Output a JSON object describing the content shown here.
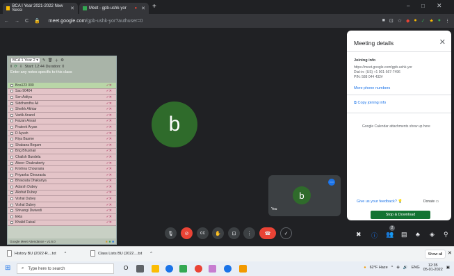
{
  "browser": {
    "tabs": [
      {
        "label": "BCA I Year 2021-2022 New Sessi",
        "active": false,
        "color": "#fbbc04"
      },
      {
        "label": "Meet - gpb-ushk-yor",
        "active": true,
        "color": "#34a853"
      }
    ],
    "url_host": "meet.google.com",
    "url_path": "/gpb-ushk-yor?authuser=0"
  },
  "extension": {
    "class_select": "BCA 1 Year 2 ▾",
    "hint": "Enter any notes specific to this class",
    "stats": "Start: 12:44 Duration: 0",
    "students": [
      "Bca123 000",
      "Sao 90404",
      "Sen Aditya",
      "Siddhandhu Ali",
      "Sheikh Akhtar",
      "Vartik Anand",
      "Faizan Ansari",
      "Prateek Aryan",
      "D Ayush",
      "Riya Basme",
      "Shabana Begam",
      "Brig Bhushan",
      "Chailsh Bundela",
      "Abeer Chakraborty",
      "Krishna Chourasia",
      "Priyanka Chourasia",
      "Bhavyata Dhakariya",
      "Adarsh Dubey",
      "Akshat Dubey",
      "Vishal Dubey",
      "Vishal Dubey",
      "Shivangi Dwivedi",
      "Ekta",
      "Khalid Faisal"
    ],
    "footer": "Google Meet Attendance - v1.6.0"
  },
  "stage": {
    "main_avatar": "b",
    "self_avatar": "b",
    "self_label": "You"
  },
  "details": {
    "title": "Meeting details",
    "joining_info": "Joining info",
    "link": "https://meet.google.com/gpb-ushk-yor",
    "dial_in": "Dial-in: (US) +1 901-567-7496",
    "pin": "PIN: 588 044 432#",
    "more_phone": "More phone numbers",
    "copy": "Copy joining info",
    "calendar_note": "Google Calendar attachments show up here",
    "feedback": "Give us your feedback?",
    "donate": "Donate",
    "save_btn": "Stop & Download"
  },
  "controls": {
    "raise_badge": "2"
  },
  "downloads": {
    "items": [
      "History BU (2022-R....txt",
      "Class Lists BU (2022....txt"
    ],
    "show_all": "Show all"
  },
  "taskbar": {
    "search_placeholder": "Type here to search",
    "weather": "62°F Haze",
    "lang": "ENG",
    "time": "12:35",
    "date": "05-01-2022"
  }
}
